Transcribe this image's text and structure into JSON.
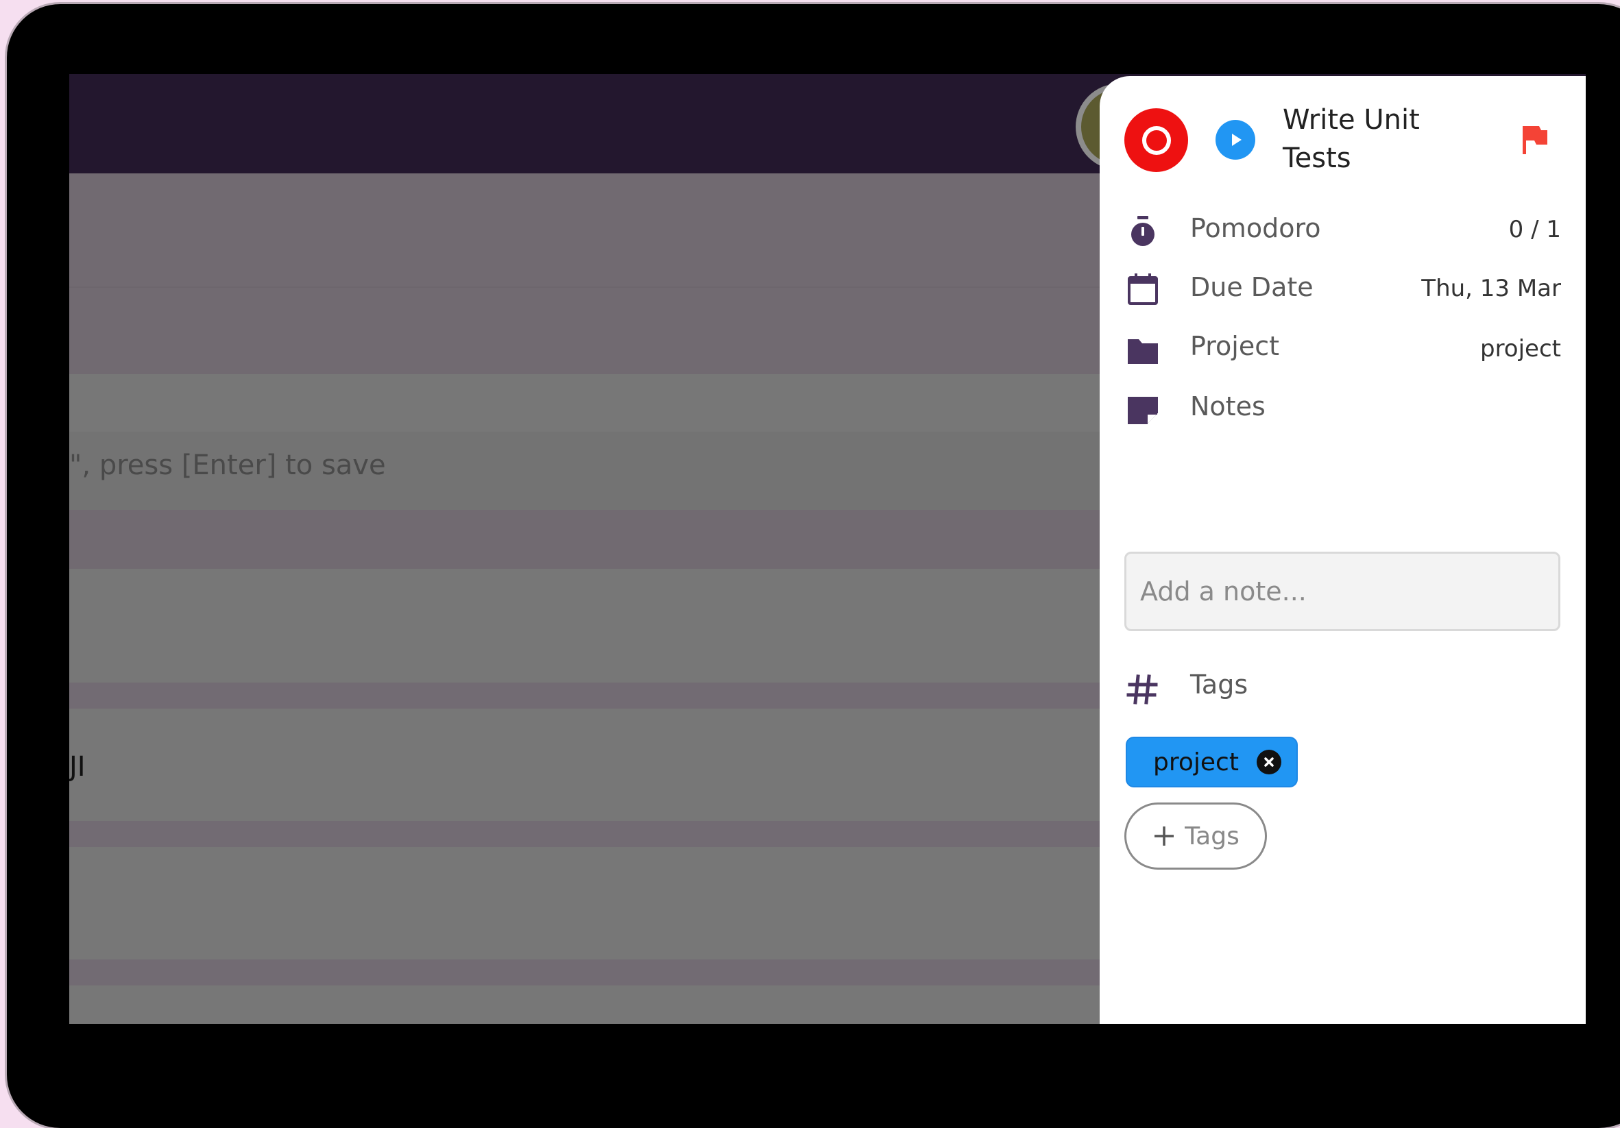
{
  "background": {
    "input_hint": "\", press [Enter] to save",
    "row_fragment": "JI"
  },
  "panel": {
    "task_title": "Write Unit Tests",
    "rows": {
      "pomodoro": {
        "label": "Pomodoro",
        "value": "0 / 1",
        "icon": "stopwatch-icon"
      },
      "due_date": {
        "label": "Due Date",
        "value": "Thu, 13 Mar",
        "icon": "calendar-icon"
      },
      "project": {
        "label": "Project",
        "value": "project",
        "icon": "folder-icon"
      },
      "notes": {
        "label": "Notes",
        "icon": "note-icon"
      },
      "tags": {
        "label": "Tags",
        "icon": "hash-icon"
      }
    },
    "notes_placeholder": "Add a note...",
    "tag_chips": [
      "project"
    ],
    "add_tag_label": "Tags"
  },
  "colors": {
    "stop": "#ee1111",
    "play": "#2196f3",
    "flag": "#f44336",
    "icon": "#4a3560",
    "header": "#23172e",
    "tag_chip": "#2196f3"
  }
}
